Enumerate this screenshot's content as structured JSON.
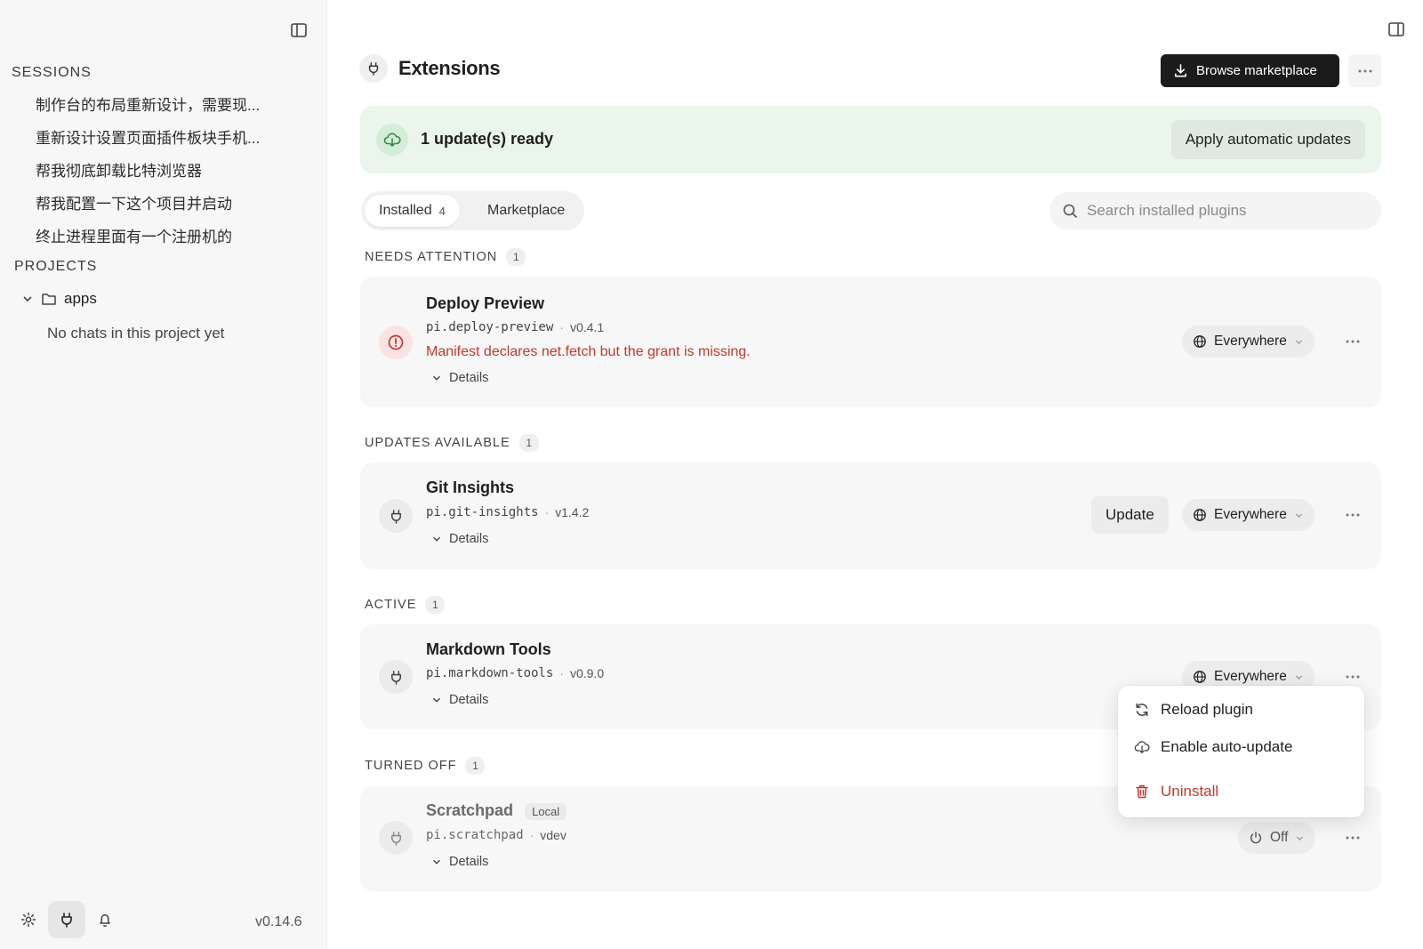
{
  "sidebar": {
    "sessions_title": "SESSIONS",
    "sessions": [
      "制作台的布局重新设计，需要现...",
      "重新设计设置页面插件板块手机...",
      "帮我彻底卸载比特浏览器",
      "帮我配置一下这个项目并启动",
      "终止进程里面有一个注册机的"
    ],
    "projects_title": "PROJECTS",
    "project_name": "apps",
    "project_empty": "No chats in this project yet",
    "version": "v0.14.6"
  },
  "header": {
    "title": "Extensions",
    "browse_label": "Browse marketplace"
  },
  "banner": {
    "text": "1 update(s) ready",
    "apply_label": "Apply automatic updates"
  },
  "tabs": [
    {
      "label": "Installed",
      "count": "4"
    },
    {
      "label": "Marketplace"
    }
  ],
  "search": {
    "placeholder": "Search installed plugins"
  },
  "groups": {
    "attention": {
      "label": "NEEDS ATTENTION",
      "count": "1"
    },
    "updates": {
      "label": "UPDATES AVAILABLE",
      "count": "1"
    },
    "active": {
      "label": "ACTIVE",
      "count": "1"
    },
    "off": {
      "label": "TURNED OFF",
      "count": "1"
    }
  },
  "plugins": {
    "deploy": {
      "name": "Deploy Preview",
      "id": "pi.deploy-preview",
      "version": "v0.4.1",
      "error": "Manifest declares net.fetch but the grant is missing.",
      "details": "Details",
      "scope": "Everywhere"
    },
    "git": {
      "name": "Git Insights",
      "id": "pi.git-insights",
      "version": "v1.4.2",
      "details": "Details",
      "update_label": "Update",
      "scope": "Everywhere"
    },
    "markdown": {
      "name": "Markdown Tools",
      "id": "pi.markdown-tools",
      "version": "v0.9.0",
      "details": "Details",
      "scope": "Everywhere"
    },
    "scratchpad": {
      "name": "Scratchpad",
      "tag": "Local",
      "id": "pi.scratchpad",
      "version": "vdev",
      "details": "Details",
      "scope": "Off"
    }
  },
  "menu": {
    "reload": "Reload plugin",
    "auto_update": "Enable auto-update",
    "uninstall": "Uninstall"
  },
  "colors": {
    "accent_dark": "#1b1b1b",
    "success_bg": "#eaf5ec",
    "danger": "#c0392b"
  },
  "icons": {
    "sidebar_toggle": "sidebar-toggle-icon",
    "plug": "plug-icon",
    "download": "download-icon",
    "cloud_download": "cloud-download-icon",
    "search": "search-icon",
    "alert": "alert-circle-icon",
    "globe": "globe-icon",
    "power": "power-icon",
    "settings": "gear-icon",
    "bell": "bell-icon"
  }
}
